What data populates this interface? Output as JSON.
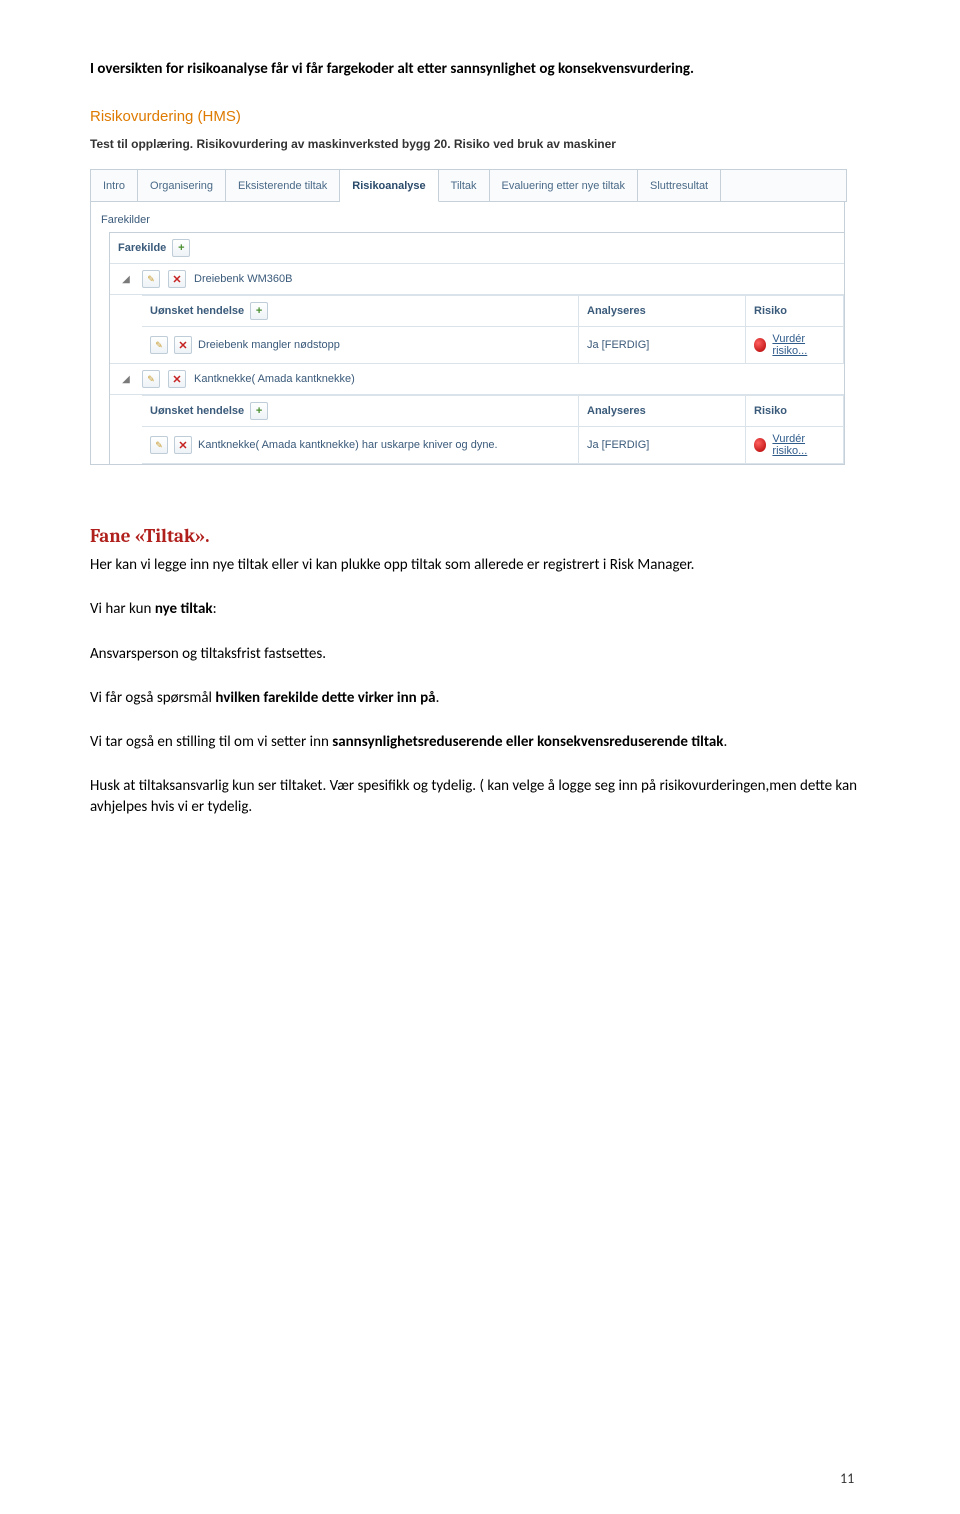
{
  "top_sentence": "I oversikten for risikoanalyse får vi får fargekoder alt etter sannsynlighet og konsekvensvurdering.",
  "screenshot": {
    "title": "Risikovurdering (HMS)",
    "subtitle": "Test til opplæring. Risikovurdering av maskinverksted bygg 20. Risiko ved bruk av maskiner",
    "tabs": [
      "Intro",
      "Organisering",
      "Eksisterende tiltak",
      "Risikoanalyse",
      "Tiltak",
      "Evaluering etter nye tiltak",
      "Sluttresultat"
    ],
    "panel_label": "Farekilder",
    "farekilde_label": "Farekilde",
    "event_label": "Uønsket hendelse",
    "analyse_label": "Analyseres",
    "risk_label": "Risiko",
    "risk_link": "Vurdér risiko...",
    "analyse_value": "Ja [FERDIG]",
    "items": [
      {
        "name": "Dreiebenk WM360B",
        "event": "Dreiebenk mangler nødstopp"
      },
      {
        "name": "Kantknekke( Amada kantknekke)",
        "event": "Kantknekke( Amada kantknekke) har uskarpe kniver og dyne."
      }
    ]
  },
  "section_heading": "Fane «Tiltak».",
  "para1": "Her kan vi legge inn nye tiltak eller vi kan plukke opp tiltak som allerede er registrert i Risk Manager.",
  "para2a": "Vi har kun ",
  "para2b": "nye tiltak",
  "para2c": ":",
  "para3": "Ansvarsperson og tiltaksfrist fastsettes.",
  "para4a": "Vi får også spørsmål ",
  "para4b": "hvilken farekilde dette virker inn på",
  "para4c": ".",
  "para5a": "Vi tar også en stilling til om vi setter inn ",
  "para5b": "sannsynlighetsreduserende eller konsekvensreduserende tiltak",
  "para5c": ".",
  "para6": "Husk at tiltaksansvarlig kun ser tiltaket. Vær spesifikk og tydelig. ( kan velge å logge seg inn på risikovurderingen,men dette kan avhjelpes hvis vi er tydelig.",
  "pagenum": "11"
}
